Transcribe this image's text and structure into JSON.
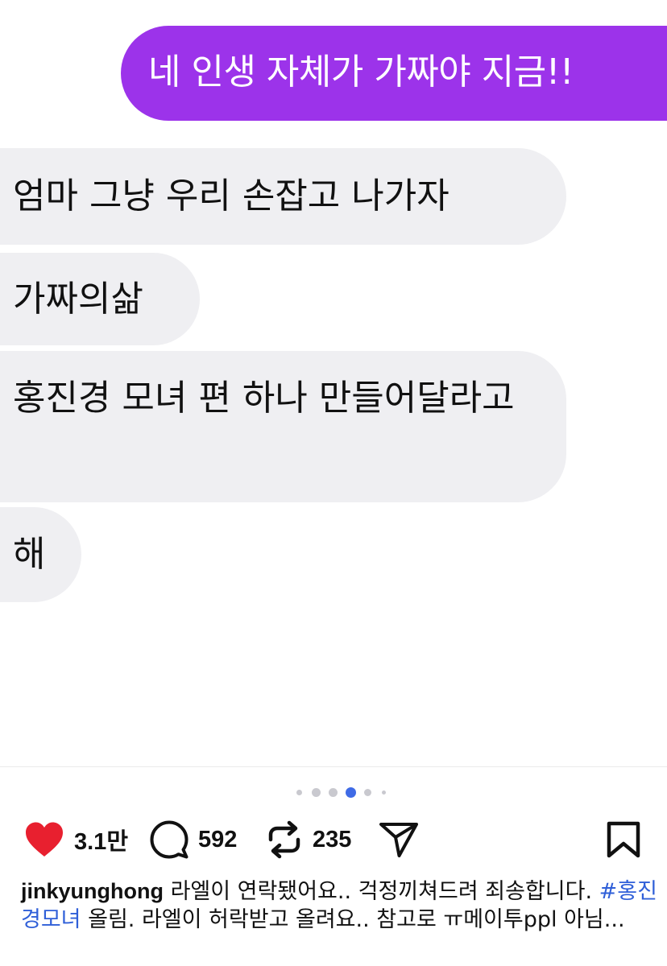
{
  "chat": {
    "outgoing": "네 인생 자체가 가짜야 지금!!",
    "incoming": [
      "엄마 그냥 우리 손잡고 나가자",
      "가짜의삶",
      "홍진경 모녀 편 하나 만들어달라고",
      "해"
    ],
    "colors": {
      "outgoing_bg": "#9c33ea",
      "incoming_bg": "#efeff2"
    }
  },
  "carousel": {
    "total_dots": 6,
    "active_index": 3,
    "active_color": "#3f6be6"
  },
  "actions": {
    "like_icon": "heart-filled-icon",
    "like_count": "3.1만",
    "comment_icon": "comment-bubble-icon",
    "comment_count": "592",
    "repost_icon": "repost-icon",
    "repost_count": "235",
    "share_icon": "send-icon",
    "save_icon": "bookmark-icon",
    "like_color": "#e8202f"
  },
  "caption": {
    "username": "jinkyunghong",
    "text_before_tag": " 라엘이 연락됐어요.. 걱정끼쳐드려 죄송합니다. ",
    "hashtag": "#홍진경모녀",
    "text_after_tag": " 올림. 라엘이 허락받고 올려요.. 참고로 ㅠ메이투ppl 아님..."
  }
}
